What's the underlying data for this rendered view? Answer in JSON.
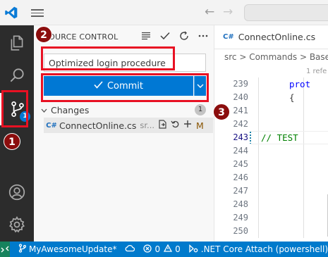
{
  "titlebar": {
    "back_glyph": "←",
    "forward_glyph": "→"
  },
  "activity_bar": {
    "items": [
      "explorer-icon",
      "search-icon",
      "source-control-icon",
      "accounts-icon",
      "manage-gear-icon"
    ],
    "source_control_badge": "1"
  },
  "source_control": {
    "title": "SOURCE CONTROL",
    "commit_message": "Optimized login procedure",
    "commit_label": "Commit",
    "changes_label": "Changes",
    "changes_count": "1",
    "file": {
      "icon_label": "C#",
      "name": "ConnectOnline.cs",
      "path": "sr...",
      "status": "M"
    }
  },
  "editor": {
    "tab_icon": "C#",
    "tab_name": "ConnectOnline.cs",
    "breadcrumb": "src > Commands > Base",
    "references": "1 refe",
    "lines": [
      {
        "num": "239",
        "code": "prot",
        "cls": "kw"
      },
      {
        "num": "240",
        "code": "{",
        "cls": ""
      },
      {
        "num": "241",
        "code": "",
        "cls": ""
      },
      {
        "num": "242",
        "code": "",
        "cls": ""
      },
      {
        "num": "243",
        "code": "// TEST",
        "cls": "cm",
        "current": true
      },
      {
        "num": "244",
        "code": "",
        "cls": ""
      },
      {
        "num": "245",
        "code": "",
        "cls": ""
      },
      {
        "num": "246",
        "code": "",
        "cls": ""
      },
      {
        "num": "247",
        "code": "",
        "cls": ""
      },
      {
        "num": "248",
        "code": "",
        "cls": ""
      },
      {
        "num": "249",
        "code": "",
        "cls": ""
      },
      {
        "num": "250",
        "code": "",
        "cls": ""
      }
    ]
  },
  "status_bar": {
    "branch": "MyAwesomeUpdate*",
    "errors": "0",
    "warnings": "0",
    "debug": ".NET Core Attach (powershell)"
  },
  "callouts": [
    "1",
    "2",
    "3"
  ],
  "colors": {
    "accent": "#0078d4",
    "statusbar": "#007acc",
    "callout_border": "#e81123",
    "callout_fill": "#8b0d0d"
  }
}
